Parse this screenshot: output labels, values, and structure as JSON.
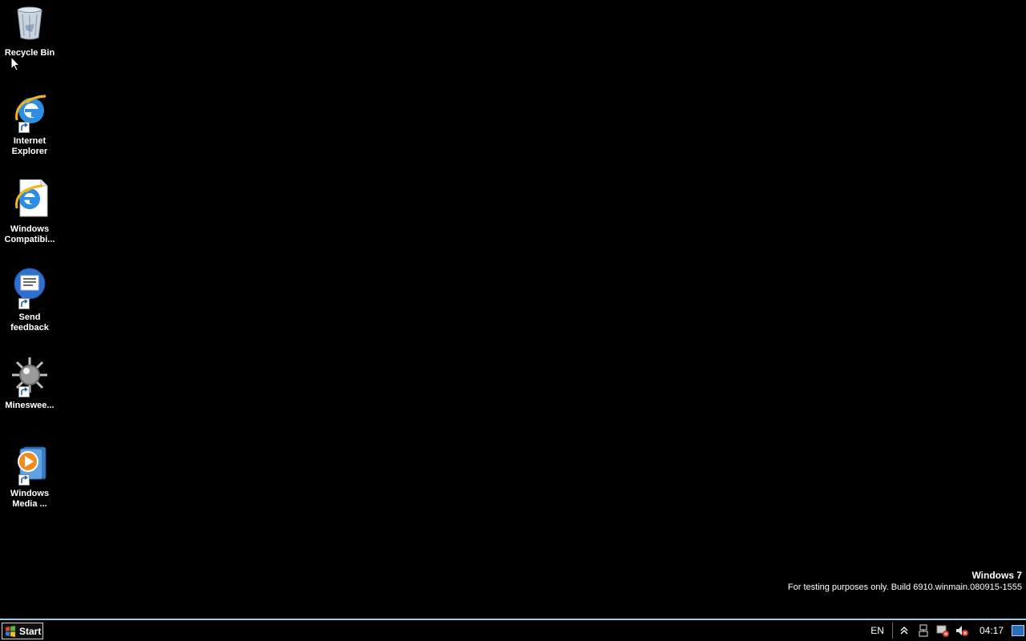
{
  "desktop": {
    "icons": [
      {
        "label": "Recycle Bin",
        "icon": "recycle-bin-icon"
      },
      {
        "label": "Internet\nExplorer",
        "icon": "internet-explorer-icon",
        "shortcut": true
      },
      {
        "label": "Windows\nCompatibi...",
        "icon": "ie-compatibility-icon"
      },
      {
        "label": "Send\nfeedback",
        "icon": "feedback-icon",
        "shortcut": true
      },
      {
        "label": "Mineswee...",
        "icon": "minesweeper-icon",
        "shortcut": true
      },
      {
        "label": "Windows\nMedia ...",
        "icon": "windows-media-player-icon",
        "shortcut": true
      }
    ]
  },
  "watermark": {
    "title": "Windows 7",
    "build": "For testing purposes only. Build 6910.winmain.080915-1555"
  },
  "taskbar": {
    "start_label": "Start",
    "language": "EN",
    "tray_icons": [
      "show-hidden-icons-icon",
      "network-icon",
      "action-center-icon",
      "volume-muted-icon"
    ],
    "clock": "04:17"
  },
  "colors": {
    "desktop_background": "#000000",
    "taskbar_border": "#9ec9e6",
    "text": "#ffffff"
  }
}
